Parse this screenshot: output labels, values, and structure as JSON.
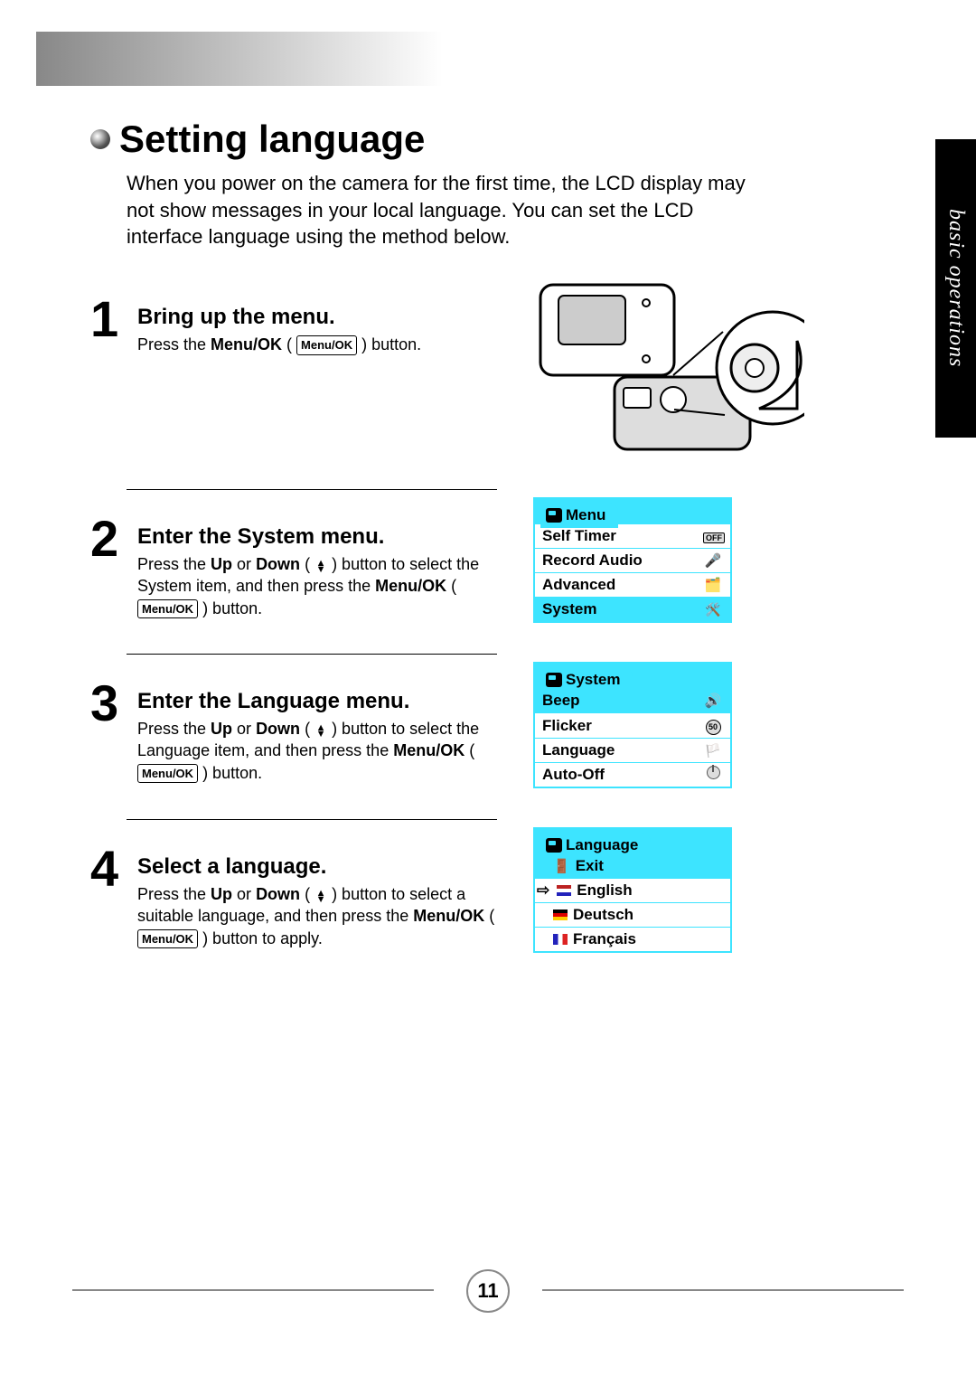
{
  "section_tab": "basic operations",
  "page_number": "11",
  "title": "Setting language",
  "intro": "When you power on the camera for the first time, the LCD display may not show messages in your local language. You can set the LCD interface language using the method below.",
  "menuok_label": "Menu/OK",
  "steps": {
    "1": {
      "num": "1",
      "title": "Bring up the menu.",
      "desc_pre": "Press the ",
      "desc_bold1": "Menu/OK",
      "desc_mid": " ( ",
      "desc_post": " ) button."
    },
    "2": {
      "num": "2",
      "title": "Enter the System menu.",
      "desc_pre": "Press the ",
      "desc_b1": "Up",
      "desc_or": " or ",
      "desc_b2": "Down",
      "desc_mid": " ( ",
      "desc_mid2": " ) button to select the System item, and then press the ",
      "desc_b3": "Menu/OK",
      "desc_mid3": " ( ",
      "desc_post": " ) button."
    },
    "3": {
      "num": "3",
      "title": "Enter the Language menu.",
      "desc_pre": "Press the ",
      "desc_b1": "Up",
      "desc_or": " or ",
      "desc_b2": "Down",
      "desc_mid": " ( ",
      "desc_mid2": " ) button to select the Language item, and then press the ",
      "desc_b3": "Menu/OK",
      "desc_mid3": " ( ",
      "desc_post": " ) button."
    },
    "4": {
      "num": "4",
      "title": "Select a language.",
      "desc_pre": "Press the ",
      "desc_b1": "Up",
      "desc_or": " or ",
      "desc_b2": "Down",
      "desc_mid": " ( ",
      "desc_mid2": " ) button to select a suitable language, and then press the ",
      "desc_b3": "Menu/OK",
      "desc_mid3": " ( ",
      "desc_post": " ) button to apply."
    }
  },
  "osd_menu": {
    "title": "Menu",
    "items": [
      {
        "label": "Self Timer",
        "icon": "off",
        "hl": false
      },
      {
        "label": "Record Audio",
        "icon": "mic",
        "hl": false
      },
      {
        "label": "Advanced",
        "icon": "tools",
        "hl": false
      },
      {
        "label": "System",
        "icon": "sys",
        "hl": true
      }
    ]
  },
  "osd_system": {
    "title": "System",
    "items": [
      {
        "label": "Beep",
        "icon": "spk",
        "hl": true
      },
      {
        "label": "Flicker",
        "icon": "50",
        "hl": false
      },
      {
        "label": "Language",
        "icon": "flag",
        "hl": false
      },
      {
        "label": "Auto-Off",
        "icon": "pwr",
        "hl": false
      }
    ]
  },
  "osd_language": {
    "title": "Language",
    "items": [
      {
        "label": "Exit",
        "flag": "door",
        "hl": true,
        "sel": false
      },
      {
        "label": "English",
        "flag": "en",
        "hl": false,
        "sel": true
      },
      {
        "label": "Deutsch",
        "flag": "de",
        "hl": false,
        "sel": false
      },
      {
        "label": "Français",
        "flag": "fr",
        "hl": false,
        "sel": false
      }
    ]
  }
}
